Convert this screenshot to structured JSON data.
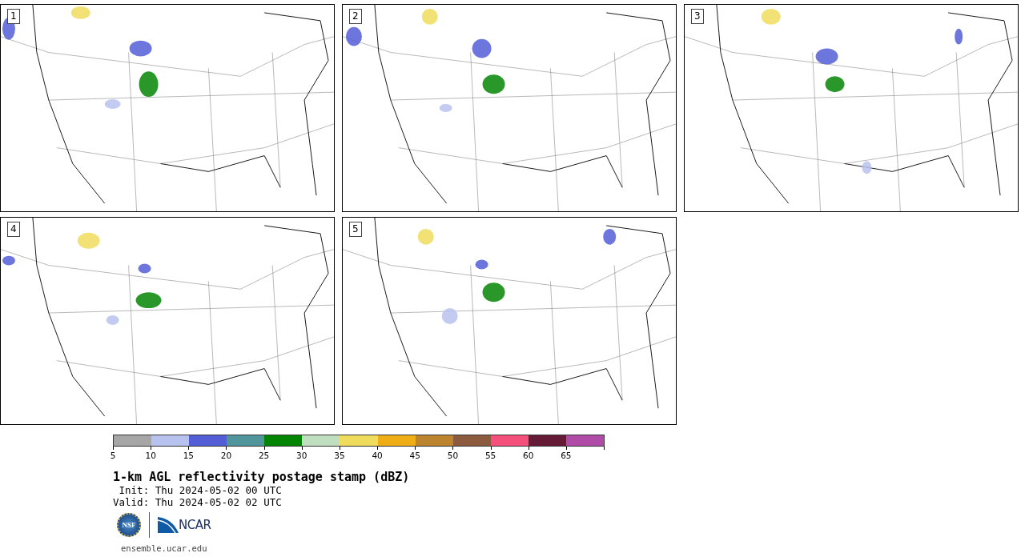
{
  "panels": [
    {
      "label": "1"
    },
    {
      "label": "2"
    },
    {
      "label": "3"
    },
    {
      "label": "4"
    },
    {
      "label": "5"
    }
  ],
  "colorbar": {
    "bins": [
      {
        "color": "#a6a6a6"
      },
      {
        "color": "#b8c2ee"
      },
      {
        "color": "#535ed6"
      },
      {
        "color": "#50959c"
      },
      {
        "color": "#038503"
      },
      {
        "color": "#c0dfc0"
      },
      {
        "color": "#f0dc5c"
      },
      {
        "color": "#f0ae16"
      },
      {
        "color": "#bc842f"
      },
      {
        "color": "#8c5b3f"
      },
      {
        "color": "#f5507c"
      },
      {
        "color": "#651a36"
      },
      {
        "color": "#b04ca8"
      }
    ],
    "ticks": [
      "5",
      "10",
      "15",
      "20",
      "25",
      "30",
      "35",
      "40",
      "45",
      "50",
      "55",
      "60",
      "65"
    ]
  },
  "title": "1-km AGL reflectivity postage stamp (dBZ)",
  "init": " Init: Thu 2024-05-02 00 UTC",
  "valid": "Valid: Thu 2024-05-02 02 UTC",
  "logos": {
    "nsf": "NSF",
    "ncar": "NCAR"
  },
  "url": "ensemble.ucar.edu"
}
